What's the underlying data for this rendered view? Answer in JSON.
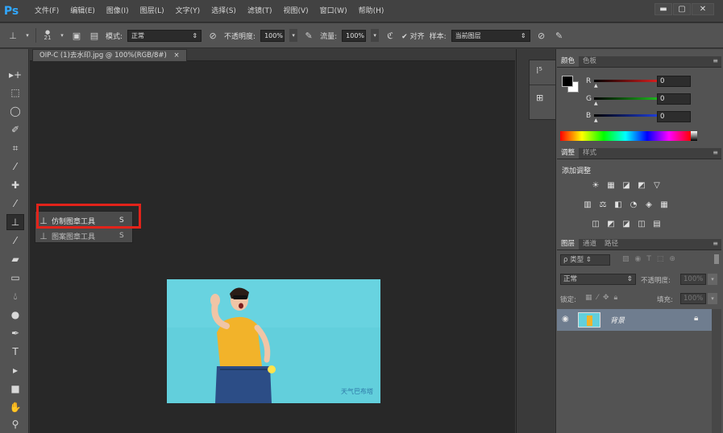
{
  "app": {
    "logo": "Ps",
    "menu": [
      "文件(F)",
      "编辑(E)",
      "图像(I)",
      "图层(L)",
      "文字(Y)",
      "选择(S)",
      "滤镜(T)",
      "视图(V)",
      "窗口(W)",
      "帮助(H)"
    ],
    "window_controls": [
      "▬",
      "▢",
      "✕"
    ]
  },
  "options_bar": {
    "brush_size": "21",
    "mode_label": "模式:",
    "mode_value": "正常",
    "opacity_label": "不透明度:",
    "opacity_value": "100%",
    "flow_label": "流量:",
    "flow_value": "100%",
    "aligned_label": "对齐",
    "sample_label": "样本:",
    "sample_value": "当前图层"
  },
  "document": {
    "tab_title": "OIP-C (1)去水印.jpg @ 100%(RGB/8#)",
    "tab_close": "×",
    "watermark": "天气巴布塔"
  },
  "flyout": {
    "items": [
      {
        "label": "仿制图章工具",
        "key": "S"
      },
      {
        "label": "图案图章工具",
        "key": "S"
      }
    ]
  },
  "color_panel": {
    "tabs": [
      "颜色",
      "色板"
    ],
    "channels": [
      {
        "name": "R",
        "value": "0",
        "color": "#e02020"
      },
      {
        "name": "G",
        "value": "0",
        "color": "#20c020"
      },
      {
        "name": "B",
        "value": "0",
        "color": "#2040e0"
      }
    ]
  },
  "adjust_panel": {
    "tabs": [
      "调整",
      "样式"
    ],
    "add_label": "添加调整",
    "icon_rows": [
      [
        "☀",
        "▦",
        "◪",
        "◩",
        "▽"
      ],
      [
        "▥",
        "⚖",
        "◧",
        "◔",
        "◈",
        "▦"
      ],
      [
        "◫",
        "◩",
        "◪",
        "◫",
        "▤"
      ]
    ]
  },
  "layers_panel": {
    "tabs": [
      "图层",
      "通道",
      "路径"
    ],
    "kind_filter": "ρ 类型",
    "blend_mode": "正常",
    "opacity_label": "不透明度:",
    "opacity_value": "100%",
    "lock_label": "锁定:",
    "fill_label": "填充:",
    "fill_value": "100%",
    "layer_name": "背景"
  }
}
